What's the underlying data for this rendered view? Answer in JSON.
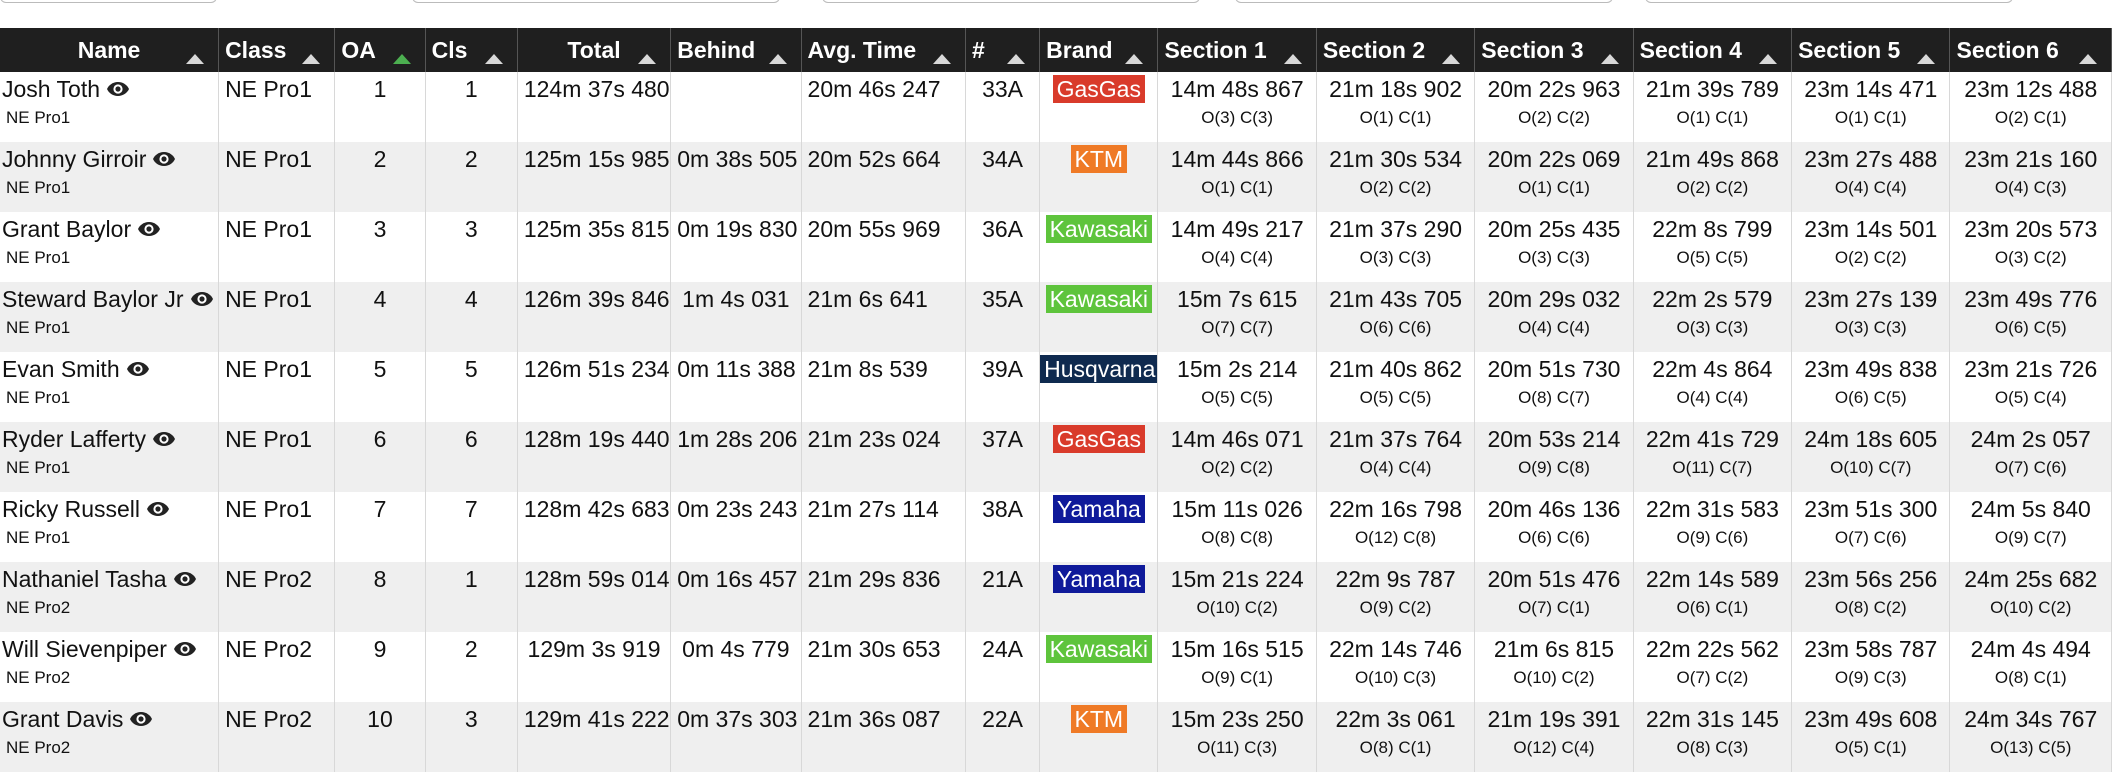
{
  "columns": [
    {
      "key": "name",
      "label": "Name",
      "align": "center",
      "sort": "none"
    },
    {
      "key": "class",
      "label": "Class",
      "align": "left",
      "sort": "none"
    },
    {
      "key": "oa",
      "label": "OA",
      "align": "left",
      "sort": "asc"
    },
    {
      "key": "cls",
      "label": "Cls",
      "align": "left",
      "sort": "none"
    },
    {
      "key": "total",
      "label": "Total",
      "align": "center",
      "sort": "none"
    },
    {
      "key": "behind",
      "label": "Behind",
      "align": "left",
      "sort": "none"
    },
    {
      "key": "avg",
      "label": "Avg. Time",
      "align": "left",
      "sort": "none"
    },
    {
      "key": "num",
      "label": "#",
      "align": "left",
      "sort": "none"
    },
    {
      "key": "brand",
      "label": "Brand",
      "align": "left",
      "sort": "none"
    },
    {
      "key": "s1",
      "label": "Section 1",
      "align": "left",
      "sort": "none"
    },
    {
      "key": "s2",
      "label": "Section 2",
      "align": "left",
      "sort": "none"
    },
    {
      "key": "s3",
      "label": "Section 3",
      "align": "left",
      "sort": "none"
    },
    {
      "key": "s4",
      "label": "Section 4",
      "align": "left",
      "sort": "none"
    },
    {
      "key": "s5",
      "label": "Section 5",
      "align": "left",
      "sort": "none"
    },
    {
      "key": "s6",
      "label": "Section 6",
      "align": "left",
      "sort": "none"
    }
  ],
  "brand_colors": {
    "GasGas": "#d93b2b",
    "KTM": "#ef7a26",
    "Kawasaki": "#5ec43c",
    "Husqvarna": "#0f2a4f",
    "Yamaha": "#0f1a9a"
  },
  "rows": [
    {
      "name": "Josh Toth",
      "class": "NE Pro1",
      "subclass": "NE Pro1",
      "oa": "1",
      "cls": "1",
      "total": "124m 37s 480",
      "behind": "",
      "avg": "20m 46s 247",
      "num": "33A",
      "brand": "GasGas",
      "sections": [
        {
          "time": "14m 48s 867",
          "rank": "O(3) C(3)"
        },
        {
          "time": "21m 18s 902",
          "rank": "O(1) C(1)"
        },
        {
          "time": "20m 22s 963",
          "rank": "O(2) C(2)"
        },
        {
          "time": "21m 39s 789",
          "rank": "O(1) C(1)"
        },
        {
          "time": "23m 14s 471",
          "rank": "O(1) C(1)"
        },
        {
          "time": "23m 12s 488",
          "rank": "O(2) C(1)"
        }
      ]
    },
    {
      "name": "Johnny Girroir",
      "class": "NE Pro1",
      "subclass": "NE Pro1",
      "oa": "2",
      "cls": "2",
      "total": "125m 15s 985",
      "behind": "0m 38s 505",
      "avg": "20m 52s 664",
      "num": "34A",
      "brand": "KTM",
      "sections": [
        {
          "time": "14m 44s 866",
          "rank": "O(1) C(1)"
        },
        {
          "time": "21m 30s 534",
          "rank": "O(2) C(2)"
        },
        {
          "time": "20m 22s 069",
          "rank": "O(1) C(1)"
        },
        {
          "time": "21m 49s 868",
          "rank": "O(2) C(2)"
        },
        {
          "time": "23m 27s 488",
          "rank": "O(4) C(4)"
        },
        {
          "time": "23m 21s 160",
          "rank": "O(4) C(3)"
        }
      ]
    },
    {
      "name": "Grant Baylor",
      "class": "NE Pro1",
      "subclass": "NE Pro1",
      "oa": "3",
      "cls": "3",
      "total": "125m 35s 815",
      "behind": "0m 19s 830",
      "avg": "20m 55s 969",
      "num": "36A",
      "brand": "Kawasaki",
      "sections": [
        {
          "time": "14m 49s 217",
          "rank": "O(4) C(4)"
        },
        {
          "time": "21m 37s 290",
          "rank": "O(3) C(3)"
        },
        {
          "time": "20m 25s 435",
          "rank": "O(3) C(3)"
        },
        {
          "time": "22m 8s 799",
          "rank": "O(5) C(5)"
        },
        {
          "time": "23m 14s 501",
          "rank": "O(2) C(2)"
        },
        {
          "time": "23m 20s 573",
          "rank": "O(3) C(2)"
        }
      ]
    },
    {
      "name": "Steward Baylor Jr",
      "class": "NE Pro1",
      "subclass": "NE Pro1",
      "oa": "4",
      "cls": "4",
      "total": "126m 39s 846",
      "behind": "1m 4s 031",
      "avg": "21m 6s 641",
      "num": "35A",
      "brand": "Kawasaki",
      "sections": [
        {
          "time": "15m 7s 615",
          "rank": "O(7) C(7)"
        },
        {
          "time": "21m 43s 705",
          "rank": "O(6) C(6)"
        },
        {
          "time": "20m 29s 032",
          "rank": "O(4) C(4)"
        },
        {
          "time": "22m 2s 579",
          "rank": "O(3) C(3)"
        },
        {
          "time": "23m 27s 139",
          "rank": "O(3) C(3)"
        },
        {
          "time": "23m 49s 776",
          "rank": "O(6) C(5)"
        }
      ]
    },
    {
      "name": "Evan Smith",
      "class": "NE Pro1",
      "subclass": "NE Pro1",
      "oa": "5",
      "cls": "5",
      "total": "126m 51s 234",
      "behind": "0m 11s 388",
      "avg": "21m 8s 539",
      "num": "39A",
      "brand": "Husqvarna",
      "sections": [
        {
          "time": "15m 2s 214",
          "rank": "O(5) C(5)"
        },
        {
          "time": "21m 40s 862",
          "rank": "O(5) C(5)"
        },
        {
          "time": "20m 51s 730",
          "rank": "O(8) C(7)"
        },
        {
          "time": "22m 4s 864",
          "rank": "O(4) C(4)"
        },
        {
          "time": "23m 49s 838",
          "rank": "O(6) C(5)"
        },
        {
          "time": "23m 21s 726",
          "rank": "O(5) C(4)"
        }
      ]
    },
    {
      "name": "Ryder Lafferty",
      "class": "NE Pro1",
      "subclass": "NE Pro1",
      "oa": "6",
      "cls": "6",
      "total": "128m 19s 440",
      "behind": "1m 28s 206",
      "avg": "21m 23s 024",
      "num": "37A",
      "brand": "GasGas",
      "sections": [
        {
          "time": "14m 46s 071",
          "rank": "O(2) C(2)"
        },
        {
          "time": "21m 37s 764",
          "rank": "O(4) C(4)"
        },
        {
          "time": "20m 53s 214",
          "rank": "O(9) C(8)"
        },
        {
          "time": "22m 41s 729",
          "rank": "O(11) C(7)"
        },
        {
          "time": "24m 18s 605",
          "rank": "O(10) C(7)"
        },
        {
          "time": "24m 2s 057",
          "rank": "O(7) C(6)"
        }
      ]
    },
    {
      "name": "Ricky Russell",
      "class": "NE Pro1",
      "subclass": "NE Pro1",
      "oa": "7",
      "cls": "7",
      "total": "128m 42s 683",
      "behind": "0m 23s 243",
      "avg": "21m 27s 114",
      "num": "38A",
      "brand": "Yamaha",
      "sections": [
        {
          "time": "15m 11s 026",
          "rank": "O(8) C(8)"
        },
        {
          "time": "22m 16s 798",
          "rank": "O(12) C(8)"
        },
        {
          "time": "20m 46s 136",
          "rank": "O(6) C(6)"
        },
        {
          "time": "22m 31s 583",
          "rank": "O(9) C(6)"
        },
        {
          "time": "23m 51s 300",
          "rank": "O(7) C(6)"
        },
        {
          "time": "24m 5s 840",
          "rank": "O(9) C(7)"
        }
      ]
    },
    {
      "name": "Nathaniel Tasha",
      "class": "NE Pro2",
      "subclass": "NE Pro2",
      "oa": "8",
      "cls": "1",
      "total": "128m 59s 014",
      "behind": "0m 16s 457",
      "avg": "21m 29s 836",
      "num": "21A",
      "brand": "Yamaha",
      "sections": [
        {
          "time": "15m 21s 224",
          "rank": "O(10) C(2)"
        },
        {
          "time": "22m 9s 787",
          "rank": "O(9) C(2)"
        },
        {
          "time": "20m 51s 476",
          "rank": "O(7) C(1)"
        },
        {
          "time": "22m 14s 589",
          "rank": "O(6) C(1)"
        },
        {
          "time": "23m 56s 256",
          "rank": "O(8) C(2)"
        },
        {
          "time": "24m 25s 682",
          "rank": "O(10) C(2)"
        }
      ]
    },
    {
      "name": "Will Sievenpiper",
      "class": "NE Pro2",
      "subclass": "NE Pro2",
      "oa": "9",
      "cls": "2",
      "total": "129m 3s 919",
      "behind": "0m 4s 779",
      "avg": "21m 30s 653",
      "num": "24A",
      "brand": "Kawasaki",
      "sections": [
        {
          "time": "15m 16s 515",
          "rank": "O(9) C(1)"
        },
        {
          "time": "22m 14s 746",
          "rank": "O(10) C(3)"
        },
        {
          "time": "21m 6s 815",
          "rank": "O(10) C(2)"
        },
        {
          "time": "22m 22s 562",
          "rank": "O(7) C(2)"
        },
        {
          "time": "23m 58s 787",
          "rank": "O(9) C(3)"
        },
        {
          "time": "24m 4s 494",
          "rank": "O(8) C(1)"
        }
      ]
    },
    {
      "name": "Grant Davis",
      "class": "NE Pro2",
      "subclass": "NE Pro2",
      "oa": "10",
      "cls": "3",
      "total": "129m 41s 222",
      "behind": "0m 37s 303",
      "avg": "21m 36s 087",
      "num": "22A",
      "brand": "KTM",
      "sections": [
        {
          "time": "15m 23s 250",
          "rank": "O(11) C(3)"
        },
        {
          "time": "22m 3s 061",
          "rank": "O(8) C(1)"
        },
        {
          "time": "21m 19s 391",
          "rank": "O(12) C(4)"
        },
        {
          "time": "22m 31s 145",
          "rank": "O(8) C(3)"
        },
        {
          "time": "23m 49s 608",
          "rank": "O(5) C(1)"
        },
        {
          "time": "24m 34s 767",
          "rank": "O(13) C(5)"
        }
      ]
    }
  ]
}
